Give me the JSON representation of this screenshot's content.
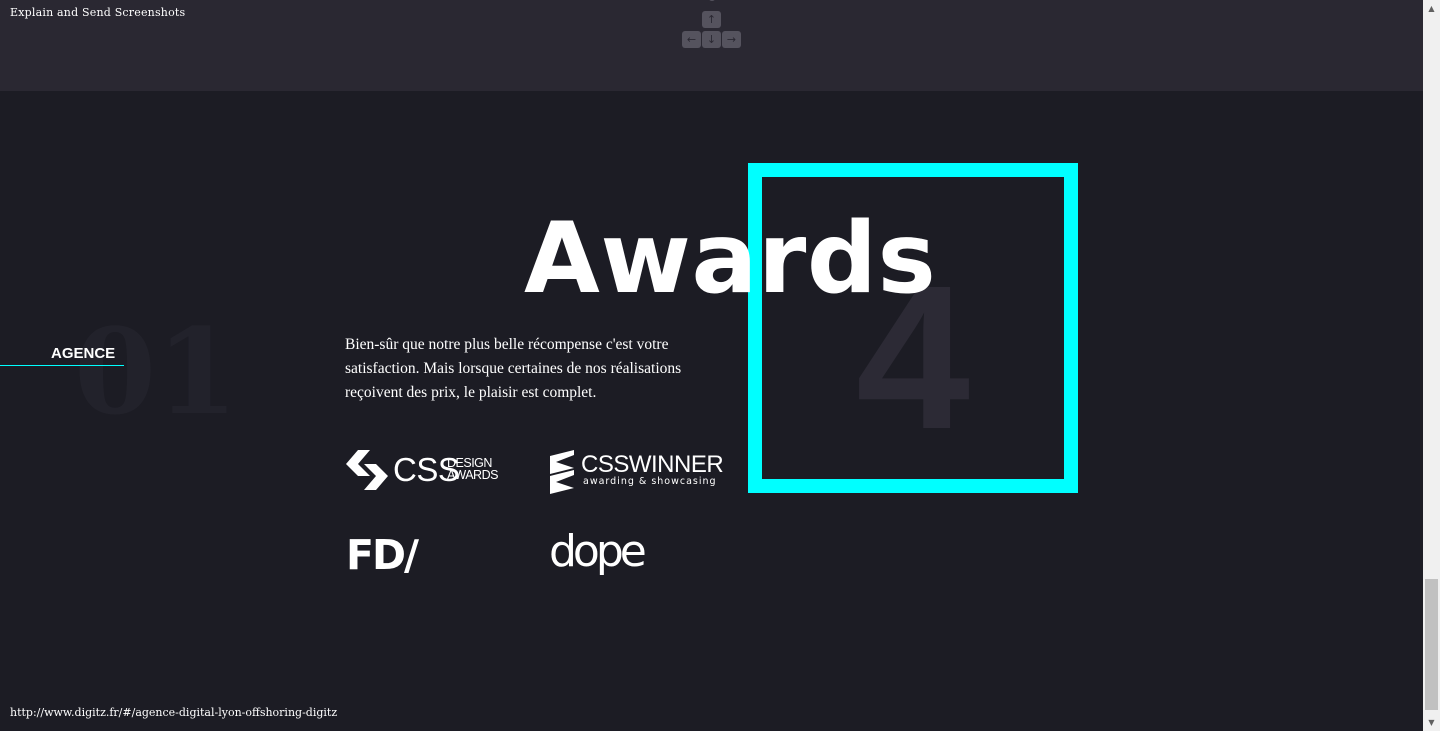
{
  "extension": {
    "title": "Explain and Send Screenshots",
    "keys": {
      "up": "↑",
      "left": "←",
      "down": "↓",
      "right": "→"
    }
  },
  "section": {
    "number": "01",
    "label": "AGENCE"
  },
  "awards": {
    "title": "Awards",
    "count": "4",
    "description": "Bien-sûr que notre plus belle récompense c'est votre satisfaction. Mais lorsque certaines de nos réalisations reçoivent des prix, le plaisir est complet.",
    "logos": {
      "css_design_awards": {
        "big": "CSS",
        "small_1": "DESIGN",
        "small_2": "AWARDS"
      },
      "css_winner": {
        "big": "CSSWINNER",
        "small": "awarding & showcasing"
      },
      "fwa": "FD/",
      "dope": "dope"
    }
  },
  "status_bar": {
    "url": "http://www.digitz.fr/#/agence-digital-lyon-offshoring-digitz"
  },
  "scrollbar": {
    "up": "▲",
    "down": "▼"
  },
  "colors": {
    "accent": "#00ffff",
    "background": "#1c1c24",
    "topbar": "#2a2832"
  }
}
